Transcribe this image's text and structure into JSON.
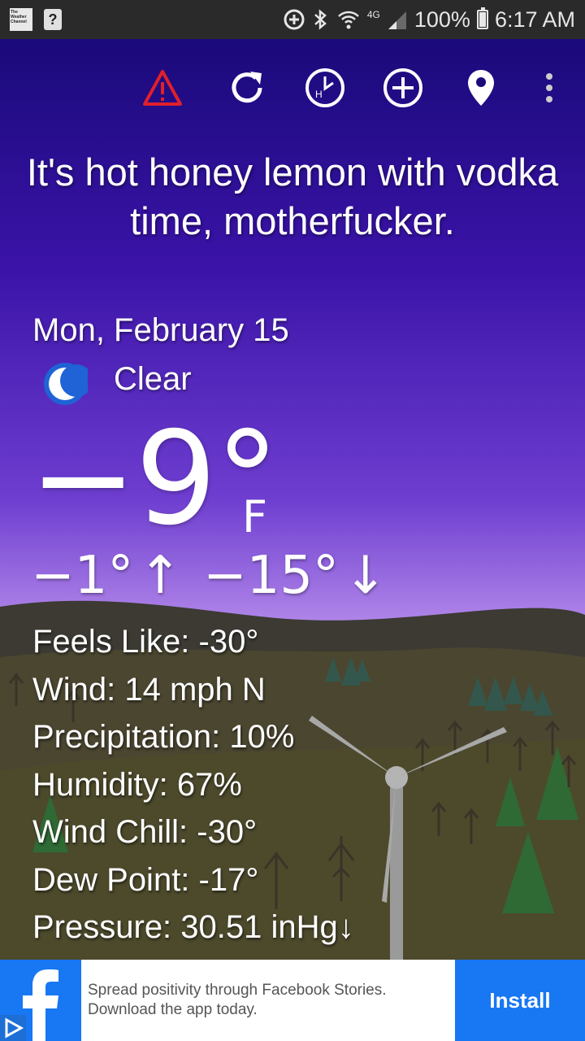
{
  "status_bar": {
    "app_logo_text": "The Weather Channel",
    "help_glyph": "?",
    "network": "4G",
    "battery": "100%",
    "time": "6:17 AM"
  },
  "toolbar": {
    "icons": [
      "alert-icon",
      "refresh-icon",
      "hourly-icon",
      "add-location-icon",
      "location-pin-icon",
      "more-vert-icon"
    ],
    "hourly_letter": "H",
    "alert_color": "#e0202a"
  },
  "headline": "It's hot honey lemon with vodka time, motherfucker.",
  "date": "Mon, February 15",
  "condition": "Clear",
  "temperature": {
    "current": "−9°",
    "unit": "F",
    "high": "−1°",
    "high_arrow": "↑",
    "low": "−15°",
    "low_arrow": "↓"
  },
  "details": {
    "feels_like": "Feels Like: -30°",
    "wind": "Wind: 14 mph N",
    "precipitation": "Precipitation: 10%",
    "humidity": "Humidity: 67%",
    "wind_chill": "Wind Chill: -30°",
    "dew_point": "Dew Point: -17°",
    "pressure": "Pressure: 30.51 inHg↓"
  },
  "ad": {
    "brand_glyph": "f",
    "text_line1": "Spread positivity through Facebook Stories.",
    "text_line2": "Download the app today.",
    "install_label": "Install",
    "brand_color": "#1877f2"
  }
}
